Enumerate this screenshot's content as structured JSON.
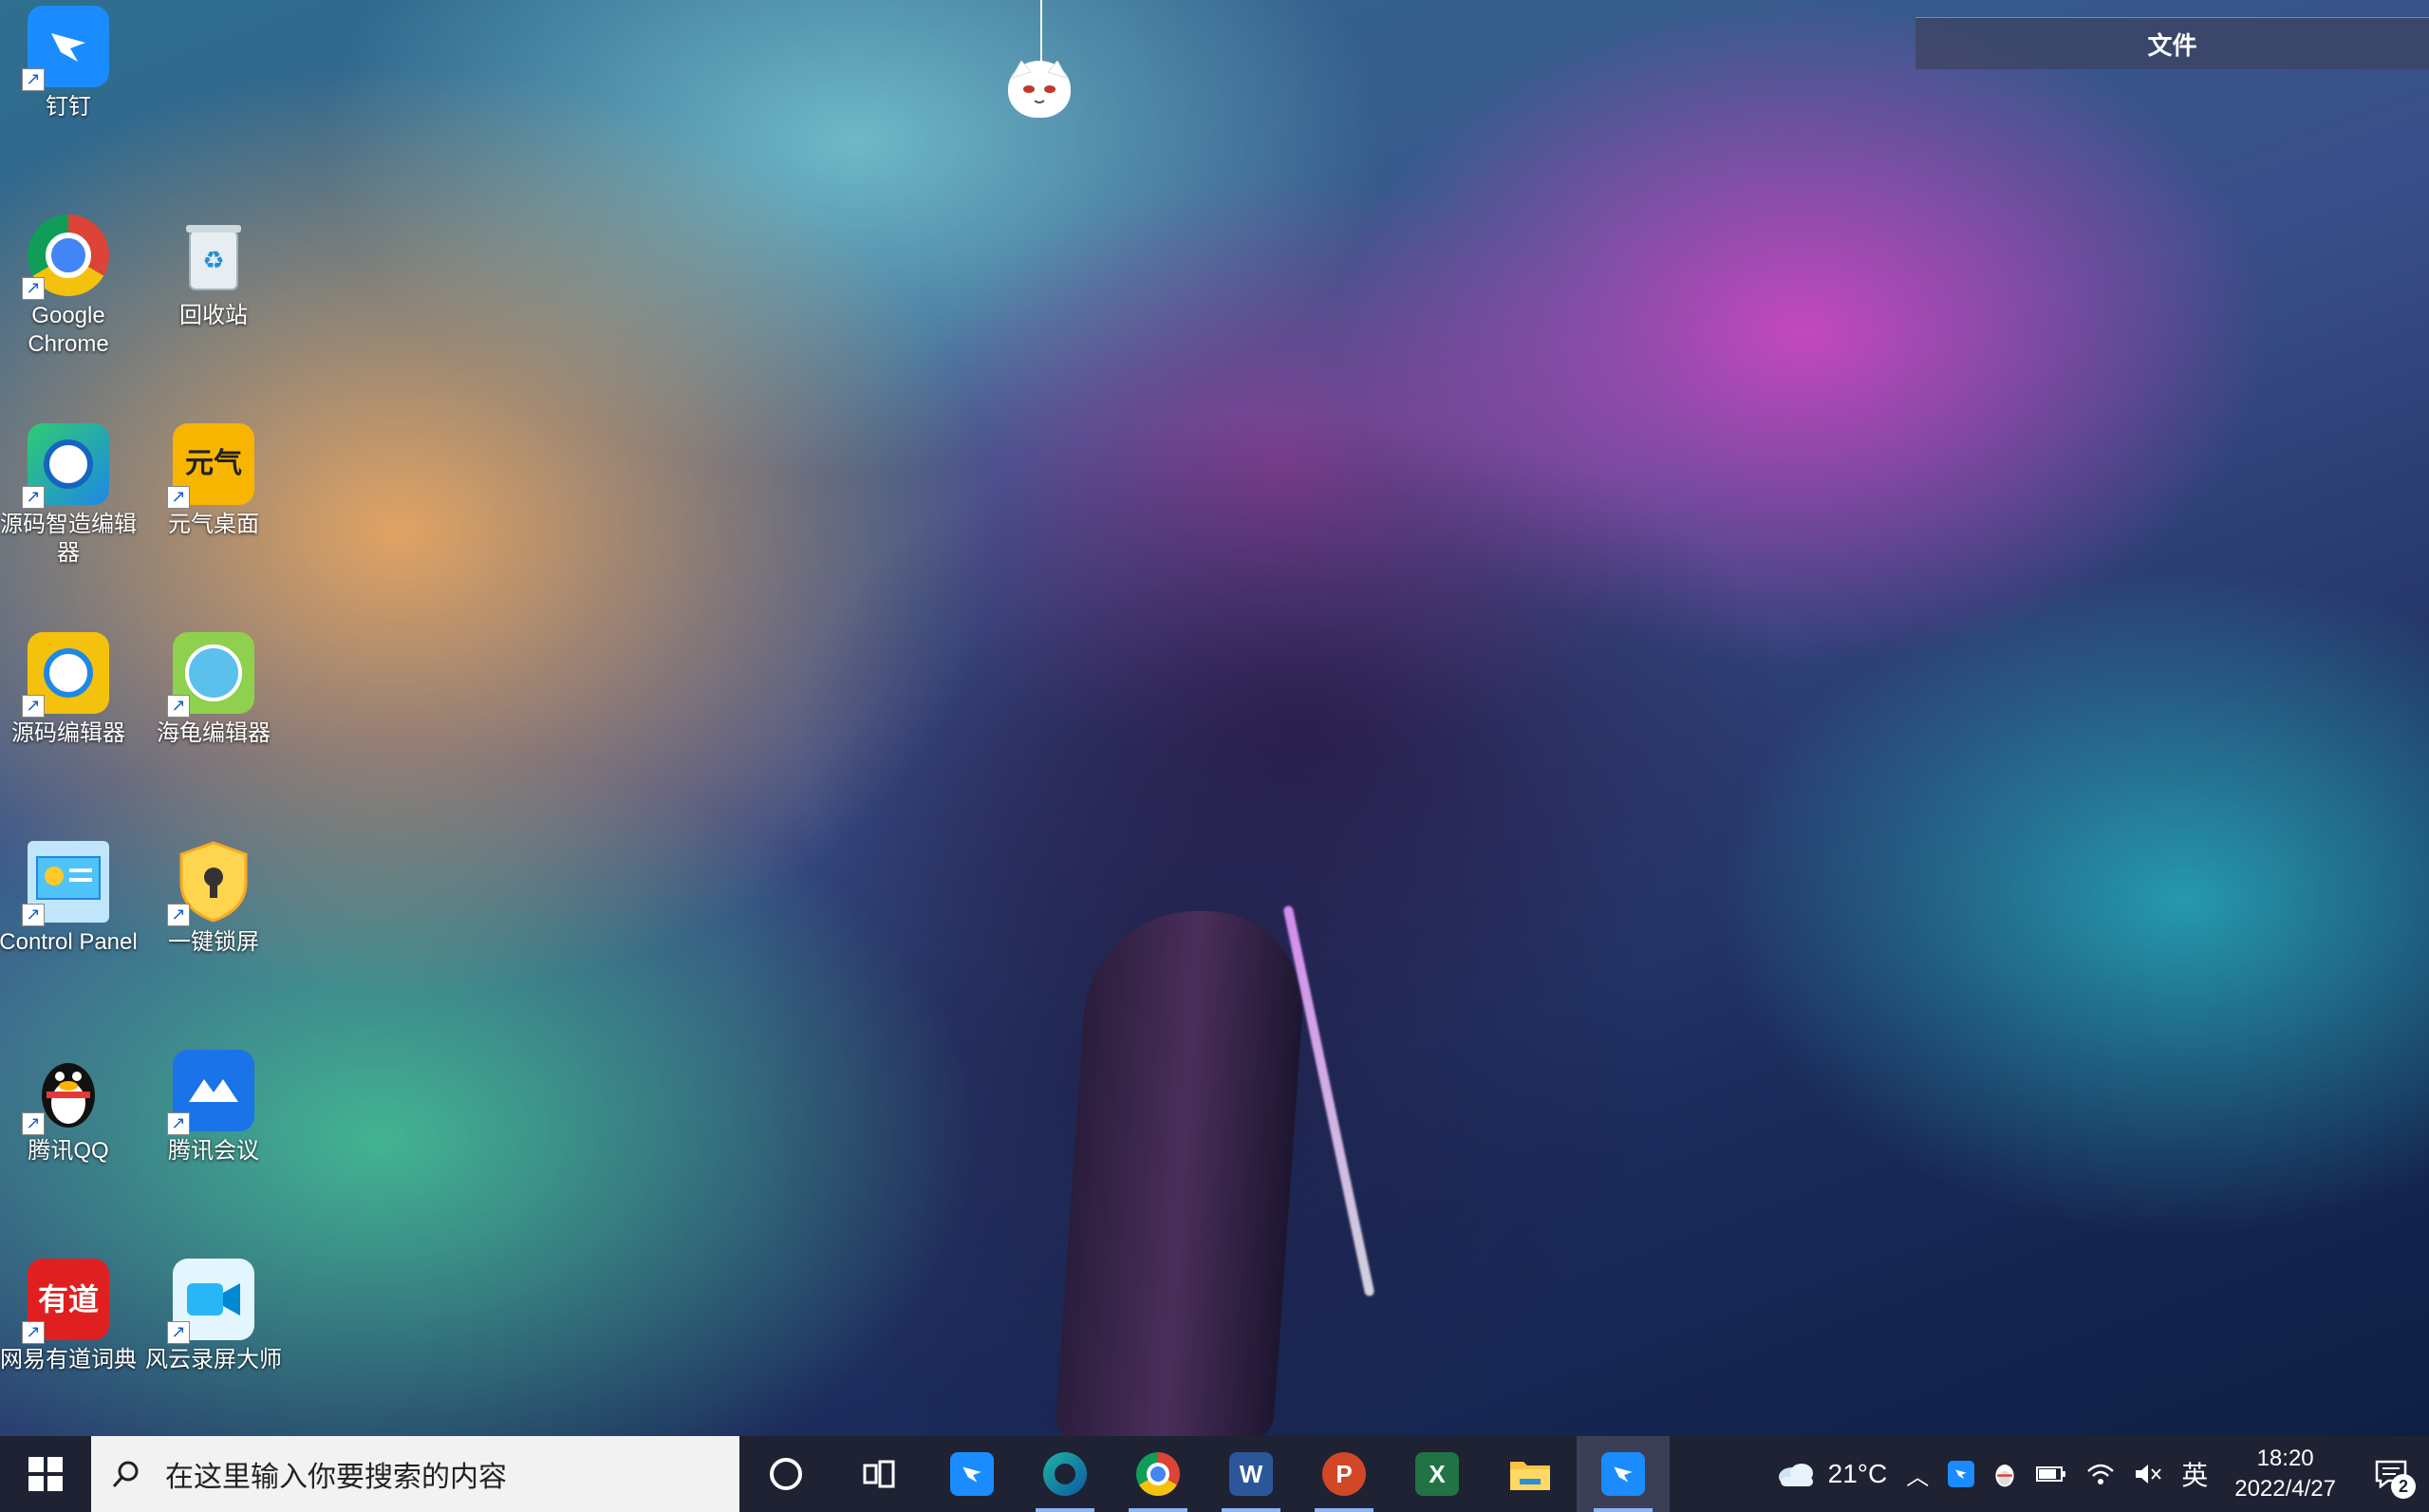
{
  "desktop_icons": [
    {
      "id": "dingtalk",
      "label": "钉钉",
      "icon": "dingtalk-icon",
      "color": "#1a8cff"
    },
    {
      "id": "chrome",
      "label": "Google Chrome",
      "icon": "chrome-icon",
      "color": "#db4437"
    },
    {
      "id": "recycle",
      "label": "回收站",
      "icon": "recycle-bin-icon",
      "color": "#cfd8dc"
    },
    {
      "id": "yuanma-zhizao",
      "label": "源码智造编辑器",
      "icon": "code-creator-icon",
      "color": "#2ecc71"
    },
    {
      "id": "yuanqi",
      "label": "元气桌面",
      "icon": "yuanqi-icon",
      "color": "#f7b500",
      "glyph": "元气"
    },
    {
      "id": "yuanma",
      "label": "源码编辑器",
      "icon": "code-editor-icon",
      "color": "#f4c20d"
    },
    {
      "id": "haigui",
      "label": "海龟编辑器",
      "icon": "turtle-editor-icon",
      "color": "#5bc0eb"
    },
    {
      "id": "control-panel",
      "label": "Control Panel",
      "icon": "control-panel-icon",
      "color": "#4fc3f7"
    },
    {
      "id": "lockscreen",
      "label": "一键锁屏",
      "icon": "lock-screen-icon",
      "color": "#ffd54f"
    },
    {
      "id": "qq",
      "label": "腾讯QQ",
      "icon": "qq-penguin-icon",
      "color": "#111111"
    },
    {
      "id": "meeting",
      "label": "腾讯会议",
      "icon": "tencent-meeting-icon",
      "color": "#1a73e8"
    },
    {
      "id": "youdao",
      "label": "网易有道词典",
      "icon": "youdao-icon",
      "color": "#e02020",
      "glyph": "有道"
    },
    {
      "id": "recorder",
      "label": "风云录屏大师",
      "icon": "screen-recorder-icon",
      "color": "#29b6f6"
    }
  ],
  "file_panel": {
    "label": "文件"
  },
  "taskbar": {
    "search_placeholder": "在这里输入你要搜索的内容",
    "apps": [
      {
        "name": "cortana",
        "icon": "cortana-circle-icon"
      },
      {
        "name": "task-view",
        "icon": "task-view-icon"
      },
      {
        "name": "dingtalk",
        "icon": "dingtalk-icon",
        "color": "#1a8cff"
      },
      {
        "name": "edge",
        "icon": "edge-icon",
        "color": "#1fb3a1"
      },
      {
        "name": "chrome",
        "icon": "chrome-icon",
        "color": "#db4437"
      },
      {
        "name": "word",
        "icon": "word-icon",
        "color": "#2b579a",
        "glyph": "W"
      },
      {
        "name": "powerpoint",
        "icon": "powerpoint-icon",
        "color": "#d24726",
        "glyph": "P"
      },
      {
        "name": "excel",
        "icon": "excel-icon",
        "color": "#217346",
        "glyph": "X"
      },
      {
        "name": "file-explorer",
        "icon": "folder-icon",
        "color": "#f6c344"
      },
      {
        "name": "dingtalk-running",
        "icon": "dingtalk-icon",
        "color": "#1a8cff"
      }
    ],
    "tray": {
      "weather": "21°C",
      "input_lang": "英",
      "time": "18:20",
      "date": "2022/4/27",
      "notification_count": "2"
    }
  }
}
